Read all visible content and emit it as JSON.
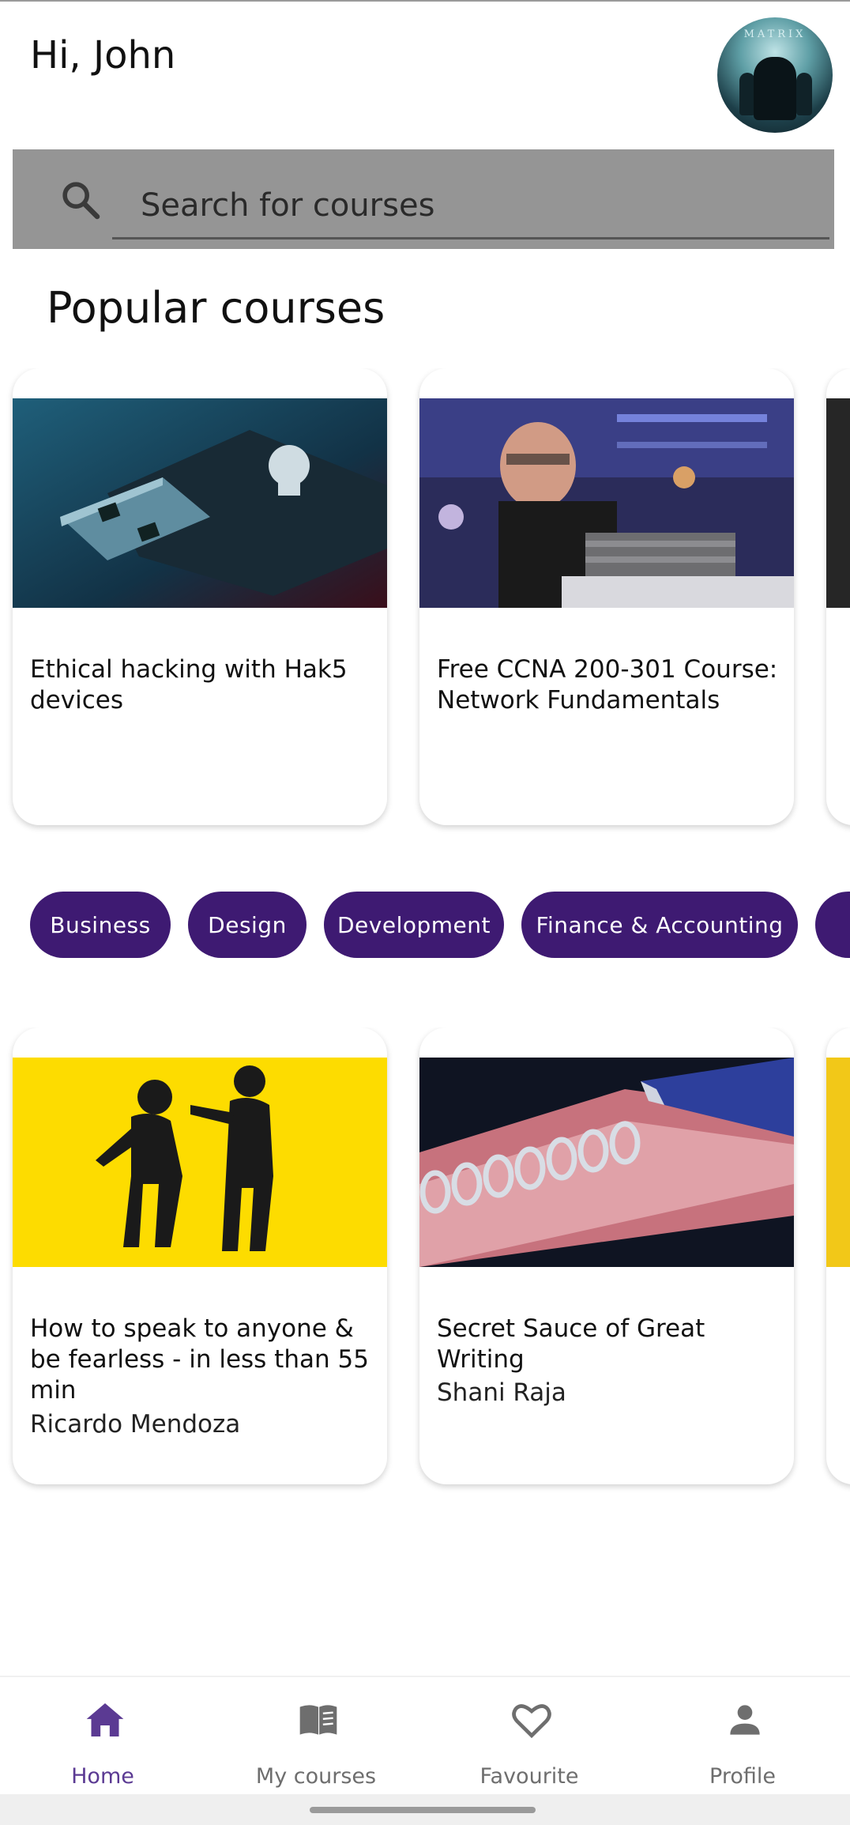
{
  "header": {
    "greeting": "Hi, John",
    "avatar_text": "MATRIX"
  },
  "search": {
    "placeholder": "Search for courses"
  },
  "popular": {
    "section_title": "Popular courses",
    "cards": [
      {
        "title": "Ethical hacking with Hak5 devices"
      },
      {
        "title": "Free CCNA 200-301 Course: Network Fundamentals"
      }
    ]
  },
  "categories": {
    "chips": [
      "Business",
      "Design",
      "Development",
      "Finance & Accounting"
    ]
  },
  "courses": {
    "cards": [
      {
        "title": "How to speak to anyone & be fearless - in less than 55 min",
        "author": "Ricardo Mendoza"
      },
      {
        "title": "Secret Sauce of Great Writing",
        "author": "Shani Raja"
      }
    ]
  },
  "nav": {
    "items": [
      {
        "label": "Home",
        "icon": "home-icon"
      },
      {
        "label": "My courses",
        "icon": "book-icon"
      },
      {
        "label": "Favourite",
        "icon": "heart-icon"
      },
      {
        "label": "Profile",
        "icon": "person-icon"
      }
    ],
    "active_color": "#5b3a93",
    "inactive_color": "#6e6e6e"
  },
  "colors": {
    "chip_bg": "#3e1a72",
    "search_bg": "#959595"
  }
}
